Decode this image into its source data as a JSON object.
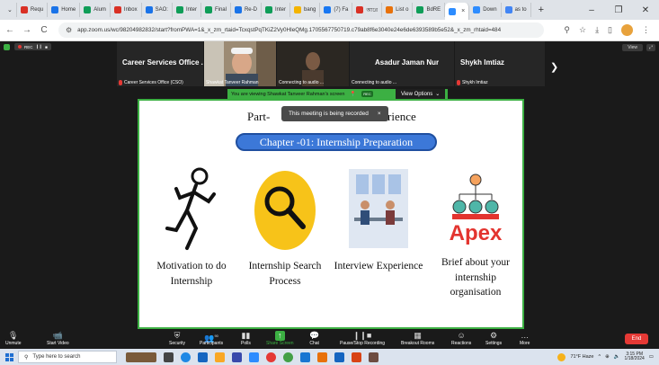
{
  "browser": {
    "tabs": [
      {
        "label": "Requ",
        "color": "#d93025"
      },
      {
        "label": "Home",
        "color": "#1a73e8"
      },
      {
        "label": "Alum",
        "color": "#0f9d58"
      },
      {
        "label": "Inbox",
        "color": "#d93025"
      },
      {
        "label": "SAO:",
        "color": "#1a73e8"
      },
      {
        "label": "Inter",
        "color": "#0f9d58"
      },
      {
        "label": "Final",
        "color": "#0f9d58"
      },
      {
        "label": "Re-D",
        "color": "#1a73e8"
      },
      {
        "label": "Inter",
        "color": "#0f9d58"
      },
      {
        "label": "bang",
        "color": "#f4b400"
      },
      {
        "label": "(7) Fa",
        "color": "#1877f2"
      },
      {
        "label": "আরে",
        "color": "#d93025"
      },
      {
        "label": "List o",
        "color": "#e8710a"
      },
      {
        "label": "BdRE",
        "color": "#0f9d58"
      },
      {
        "label": "",
        "color": "#2d8cff",
        "active": true
      },
      {
        "label": "Down",
        "color": "#2d8cff"
      },
      {
        "label": "as to",
        "color": "#4285f4"
      }
    ],
    "new_tab": "+",
    "window_controls": [
      "–",
      "❐",
      "✕"
    ],
    "url": "app.zoom.us/wc/98204982832/start?fromPWA=1&_x_zm_rtaid=TcxqstPqTKiZ2Vy0HIeQMg.1705567750719.c79ab8f6e3040e24e6de6393589b5e52&_x_zm_rhtaid=484"
  },
  "zoom": {
    "recording_label": "REC",
    "view_label": "View",
    "participants": [
      {
        "name": "Career Services Office ...",
        "label": "Career Services Office (CSO)"
      },
      {
        "name": "",
        "label": "Shawkat Tanveer Rahman"
      },
      {
        "name": "",
        "label": "Connecting to audio ..."
      },
      {
        "name": "Asadur Jaman Nur",
        "label": "Connecting to audio ..."
      },
      {
        "name": "Shykh Imtiaz",
        "label": "Shykh Imtiaz"
      }
    ],
    "share_banner": "You are viewing  Shawkat Tanveer Rahman's screen",
    "share_banner_rec": "REC",
    "view_options": "View Options",
    "slide": {
      "heading_left": "Part-",
      "heading_right": "rience",
      "tooltip": "This meeting is being recorded",
      "tooltip_close": "×",
      "chapter": "Chapter -01:  Internship Preparation",
      "cards": [
        {
          "label": "Motivation to do Internship"
        },
        {
          "label": "Internship Search Process"
        },
        {
          "label": "Interview Experience"
        },
        {
          "label": "Brief about your internship organisation"
        }
      ],
      "apex_text": "Apex"
    },
    "toolbar": {
      "unmute": "Unmute",
      "start_video": "Start Video",
      "security": "Security",
      "participants": "Participants",
      "participant_count": "90",
      "polls": "Polls",
      "share_screen": "Share Screen",
      "chat": "Chat",
      "pause_recording": "Pause/Stop Recording",
      "breakout": "Breakout Rooms",
      "reactions": "Reactions",
      "settings": "Settings",
      "more": "More",
      "end": "End"
    }
  },
  "taskbar": {
    "search_placeholder": "Type here to search",
    "weather": "71°F  Haze",
    "time": "3:15 PM",
    "date": "1/18/2024"
  }
}
